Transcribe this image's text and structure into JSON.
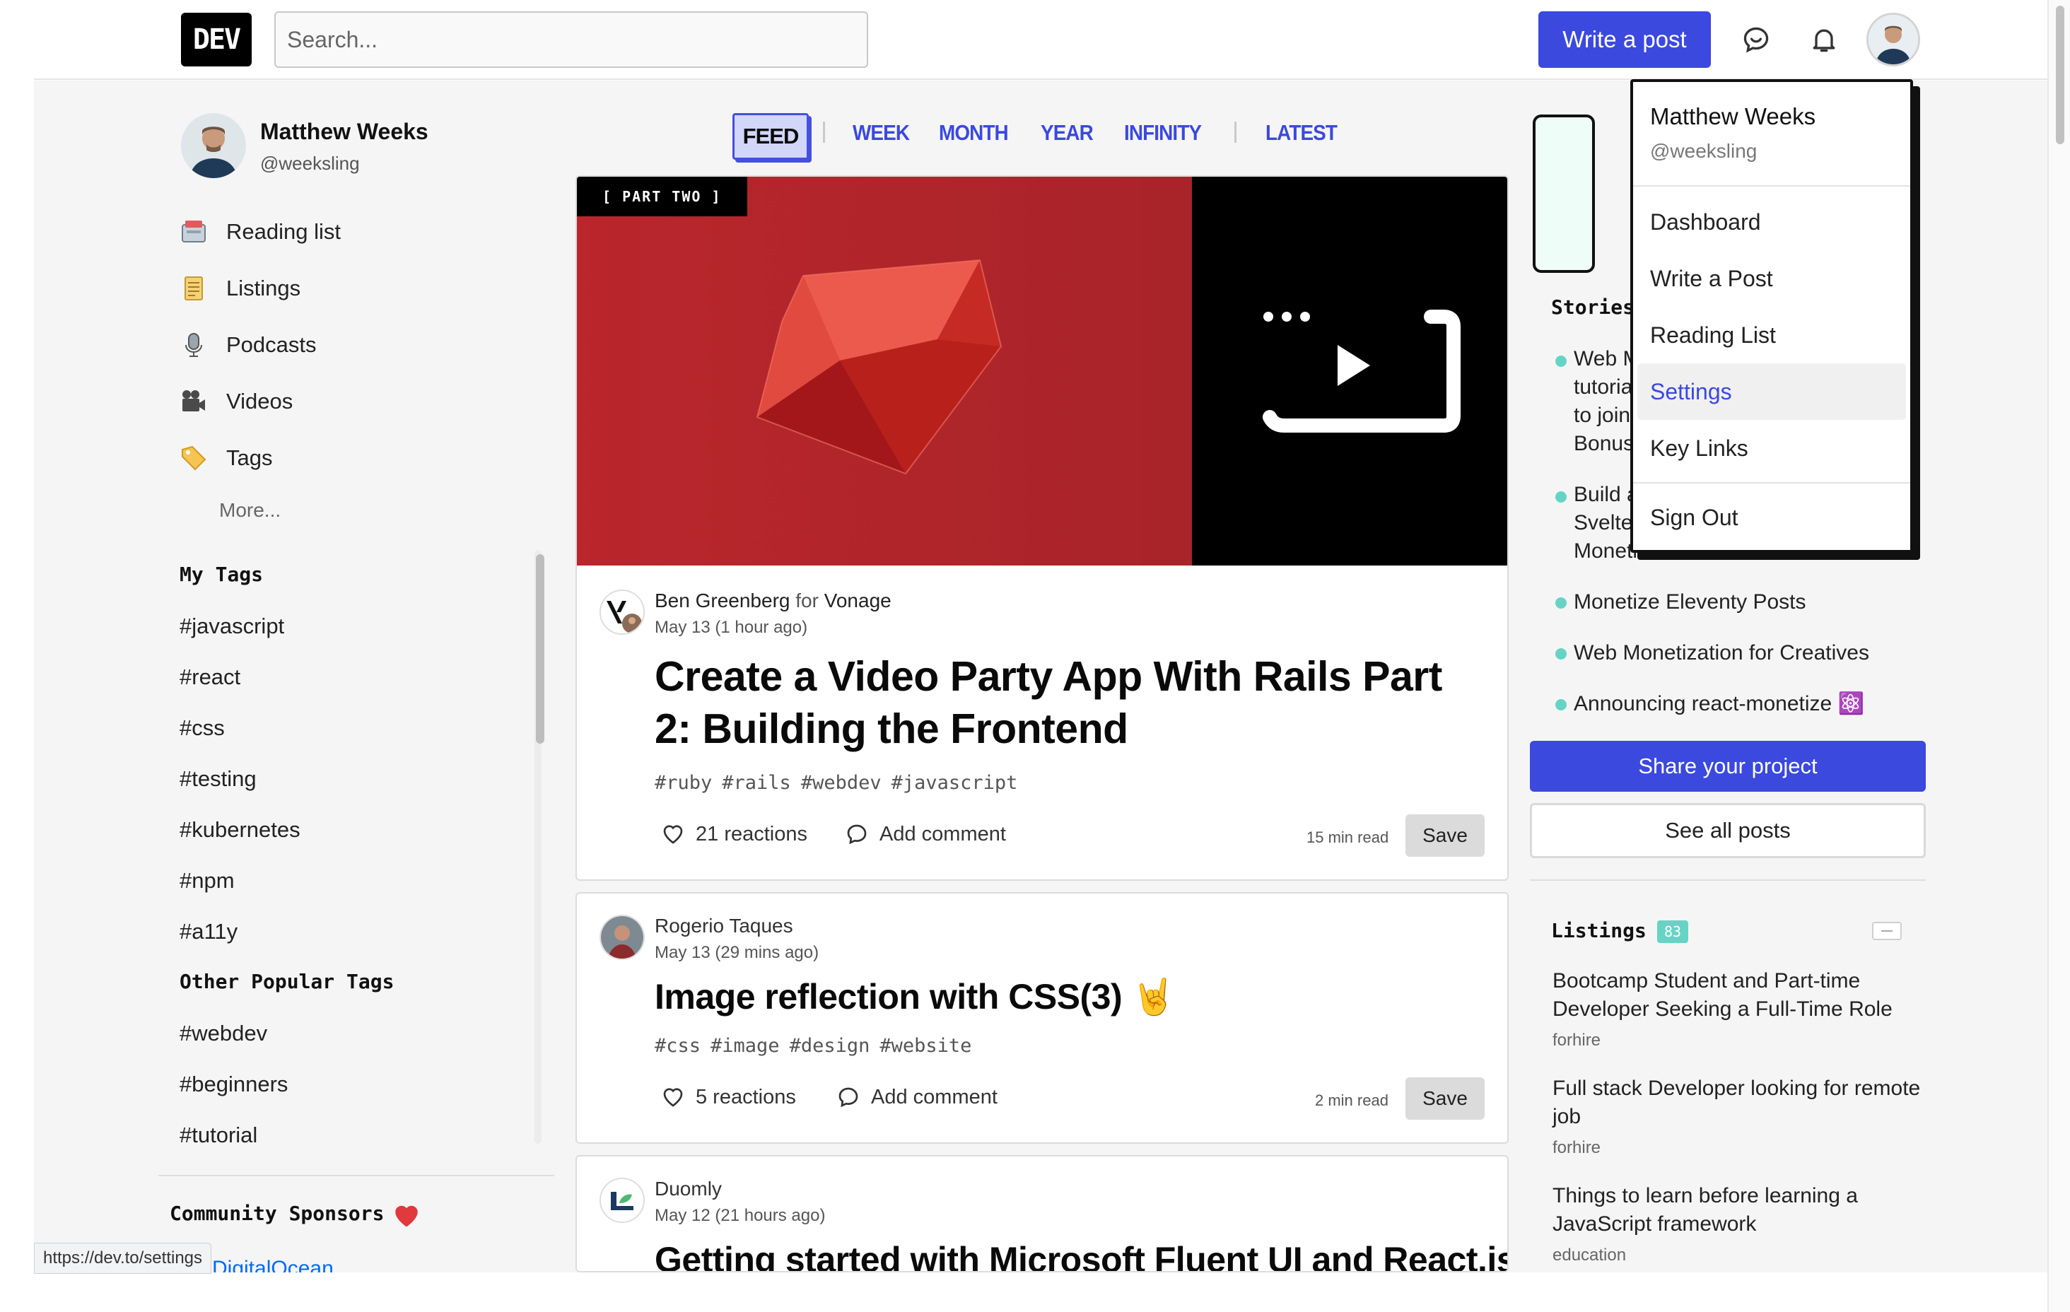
{
  "header": {
    "logo": "DEV",
    "search_placeholder": "Search...",
    "write_post": "Write a post"
  },
  "profile": {
    "name": "Matthew Weeks",
    "handle": "@weeksling"
  },
  "sidebar": {
    "nav": [
      {
        "label": "Reading list",
        "icon": "reading-list-icon"
      },
      {
        "label": "Listings",
        "icon": "listings-icon"
      },
      {
        "label": "Podcasts",
        "icon": "podcasts-icon"
      },
      {
        "label": "Videos",
        "icon": "videos-icon"
      },
      {
        "label": "Tags",
        "icon": "tags-icon"
      }
    ],
    "more": "More...",
    "my_tags_title": "My Tags",
    "my_tags": [
      "#javascript",
      "#react",
      "#css",
      "#testing",
      "#kubernetes",
      "#npm",
      "#a11y"
    ],
    "popular_title": "Other Popular Tags",
    "popular_tags": [
      "#webdev",
      "#beginners",
      "#tutorial"
    ],
    "sponsors_title": "Community Sponsors",
    "sponsor_clipped": "DigitalOcean"
  },
  "feed_tabs": [
    "FEED",
    "WEEK",
    "MONTH",
    "YEAR",
    "INFINITY",
    "LATEST"
  ],
  "posts": [
    {
      "cover_badge": "[ PART TWO ]",
      "author": "Ben Greenberg",
      "for_word": "for",
      "org": "Vonage",
      "date": "May 13 (1 hour ago)",
      "title": "Create a Video Party App With Rails Part 2: Building the Frontend",
      "tags": [
        "#ruby",
        "#rails",
        "#webdev",
        "#javascript"
      ],
      "reactions": "21 reactions",
      "comment": "Add comment",
      "read_time": "15 min read",
      "save": "Save"
    },
    {
      "author": "Rogerio Taques",
      "date": "May 13 (29 mins ago)",
      "title": "Image reflection with CSS(3) 🤘",
      "tags": [
        "#css",
        "#image",
        "#design",
        "#website"
      ],
      "reactions": "5 reactions",
      "comment": "Add comment",
      "read_time": "2 min read",
      "save": "Save"
    },
    {
      "author": "Duomly",
      "date": "May 12 (21 hours ago)",
      "title": "Getting started with Microsoft Fluent UI and React.js"
    }
  ],
  "right": {
    "stories_title": "Stories",
    "stories": [
      {
        "lines": [
          "Web M",
          "tutoria",
          "to join",
          "Bonus"
        ]
      },
      {
        "lines": [
          "Build a",
          "Svelte",
          "Monetization API"
        ]
      },
      {
        "lines": [
          "Monetize Eleventy Posts"
        ]
      },
      {
        "lines": [
          "Web Monetization for Creatives"
        ]
      },
      {
        "lines": [
          "Announcing react-monetize ⚛️"
        ]
      }
    ],
    "share": "Share your project",
    "see_all": "See all posts",
    "listings_title": "Listings",
    "listings_count": "83",
    "listings": [
      {
        "title": "Bootcamp Student and Part-time Developer Seeking a Full-Time Role",
        "category": "forhire"
      },
      {
        "title": "Full stack Developer looking for remote job",
        "category": "forhire"
      },
      {
        "title": "Things to learn before learning a JavaScript framework",
        "category": "education"
      }
    ]
  },
  "dropdown": {
    "name": "Matthew Weeks",
    "handle": "@weeksling",
    "items": [
      "Dashboard",
      "Write a Post",
      "Reading List",
      "Settings",
      "Key Links"
    ],
    "sign_out": "Sign Out"
  },
  "status_bar": {
    "url": "https://dev.to/settings"
  },
  "colors": {
    "accent": "#3b49df",
    "ruby_red": "#b9262c",
    "mint": "#67d3c5",
    "page_bg": "#f5f5f5"
  }
}
